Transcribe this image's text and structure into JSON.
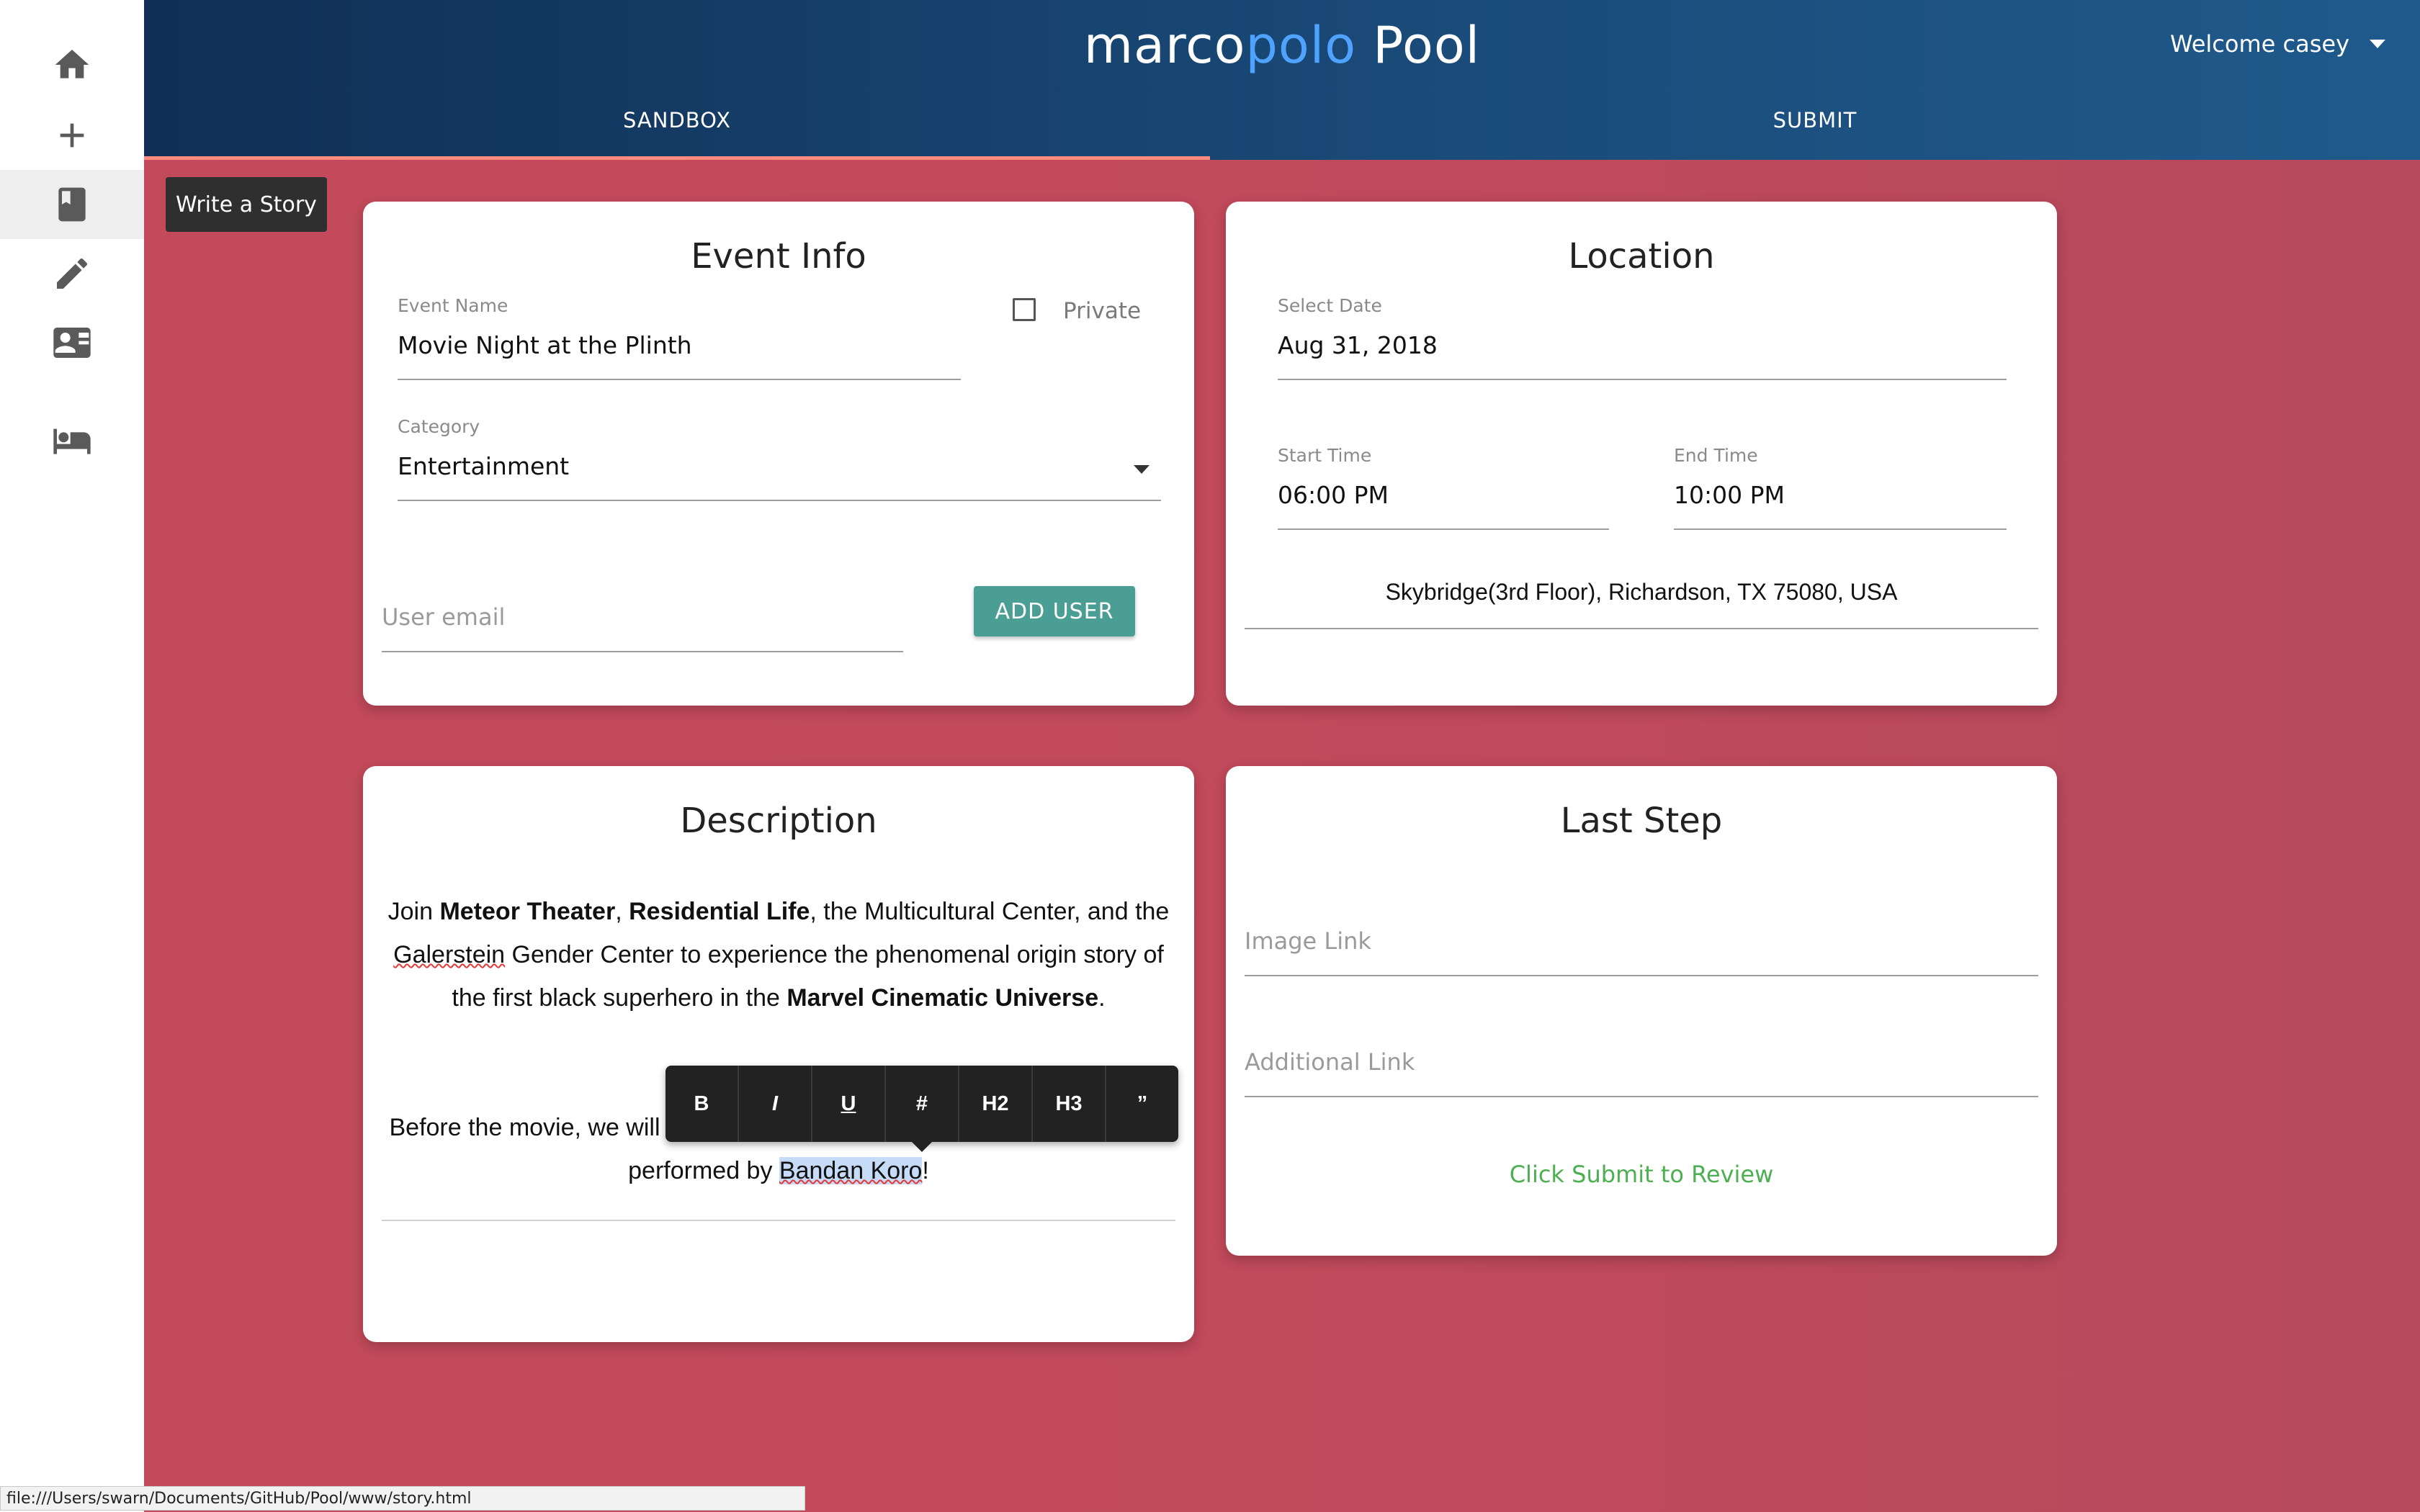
{
  "app": {
    "brand_part1": "marco",
    "brand_part2": "polo",
    "brand_part3": " Pool",
    "welcome": "Welcome casey"
  },
  "tabs": [
    {
      "label": "SANDBOX",
      "active": true
    },
    {
      "label": "SUBMIT",
      "active": false
    }
  ],
  "sidebar": {
    "items": [
      {
        "icon": "home-icon"
      },
      {
        "icon": "plus-icon"
      },
      {
        "icon": "book-icon",
        "active": true
      },
      {
        "icon": "pencil-icon"
      },
      {
        "icon": "contact-card-icon"
      },
      {
        "icon": "bed-icon"
      }
    ],
    "tooltip": "Write a Story"
  },
  "event_info": {
    "title": "Event Info",
    "event_name_label": "Event Name",
    "event_name_value": "Movie Night at the Plinth",
    "private_label": "Private",
    "category_label": "Category",
    "category_value": "Entertainment",
    "user_email_placeholder": "User email",
    "add_user_label": "ADD USER"
  },
  "location": {
    "title": "Location",
    "date_label": "Select Date",
    "date_value": "Aug 31, 2018",
    "start_label": "Start Time",
    "start_value": "06:00 PM",
    "end_label": "End Time",
    "end_value": "10:00 PM",
    "address": "Skybridge(3rd Floor), Richardson, TX 75080, USA"
  },
  "description": {
    "title": "Description",
    "p1": {
      "t1": "Join ",
      "b1": "Meteor Theater",
      "t2": ", ",
      "b2": "Residential Life",
      "t3": ", the Multicultural Center, and the ",
      "sq1": "Galerstein",
      "t4": " Gender Center to experience the phenomenal origin story of the first black superhero in the ",
      "b3": "Marvel Cinematic Universe",
      "t5": "."
    },
    "p2": {
      "t1": "Before the movie, we will have an exclusive hip-hop dance performance performed by ",
      "sel": "Bandan Koro",
      "t2": "!"
    },
    "toolbar": [
      "B",
      "I",
      "U",
      "#",
      "H2",
      "H3",
      "”"
    ]
  },
  "last_step": {
    "title": "Last Step",
    "image_placeholder": "Image Link",
    "additional_placeholder": "Additional Link",
    "submit_note": "Click Submit to Review"
  },
  "status_url": "file:///Users/swarn/Documents/GitHub/Pool/www/story.html",
  "colors": {
    "header": "#1a4a78",
    "brand_accent": "#4fa3ff",
    "background": "#c14a5b",
    "button": "#4a9e93",
    "submit_note": "#4caf50",
    "tab_indicator": "#ff8a80"
  }
}
